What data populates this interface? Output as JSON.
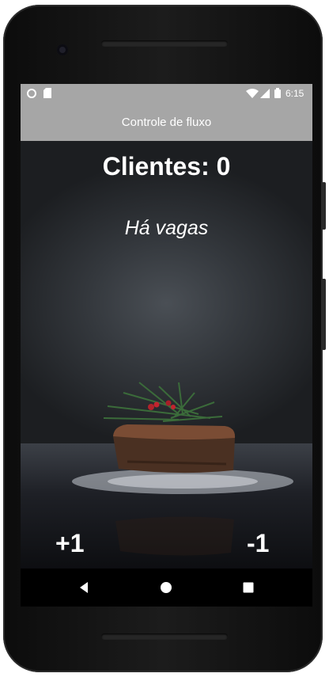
{
  "status_bar": {
    "time": "6:15"
  },
  "app_bar": {
    "title": "Controle de fluxo"
  },
  "main": {
    "clients_label": "Clientes: 0",
    "vacancy_status": "Há vagas",
    "increment_label": "+1",
    "decrement_label": "-1"
  },
  "nav_bar": {
    "icons": [
      "back-icon",
      "home-icon",
      "recents-icon"
    ]
  },
  "colors": {
    "app_bar_bg": "#a6a6a6",
    "text": "#ffffff",
    "nav_bg": "#000000"
  }
}
